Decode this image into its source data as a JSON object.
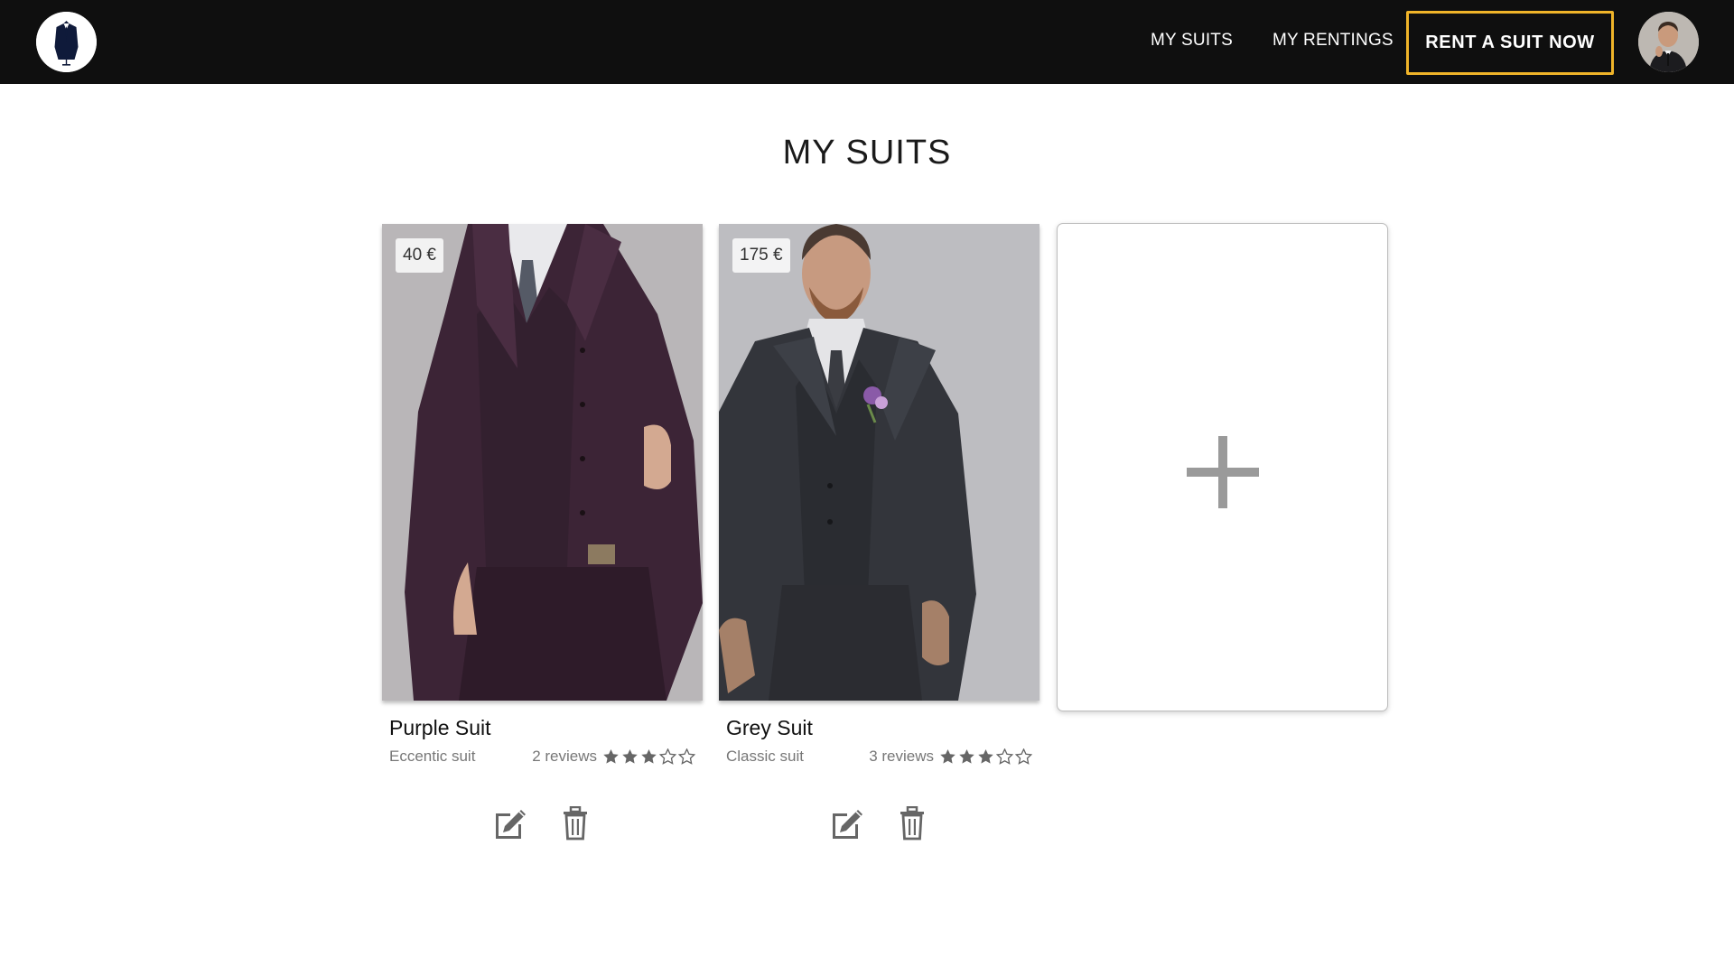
{
  "navbar": {
    "logo_icon": "suit-logo-icon",
    "links": {
      "my_suits": "MY SUITS",
      "my_rentings": "MY RENTINGS"
    },
    "cta_label": "RENT A SUIT NOW",
    "cta_border_color": "#f0b429",
    "avatar_icon": "user-avatar"
  },
  "page": {
    "title": "MY SUITS"
  },
  "suits": [
    {
      "price": "40 €",
      "name": "Purple Suit",
      "category": "Eccentic suit",
      "reviews": "2 reviews",
      "rating": 3,
      "rating_max": 5,
      "suit_color": "#3c2436"
    },
    {
      "price": "175 €",
      "name": "Grey Suit",
      "category": "Classic suit",
      "reviews": "3 reviews",
      "rating": 3,
      "rating_max": 5,
      "suit_color": "#33353b"
    }
  ],
  "add_card": {
    "icon": "plus-icon"
  },
  "icons": {
    "edit": "edit-icon",
    "delete": "trash-icon",
    "star_filled": "star-filled-icon",
    "star_empty": "star-empty-icon"
  }
}
